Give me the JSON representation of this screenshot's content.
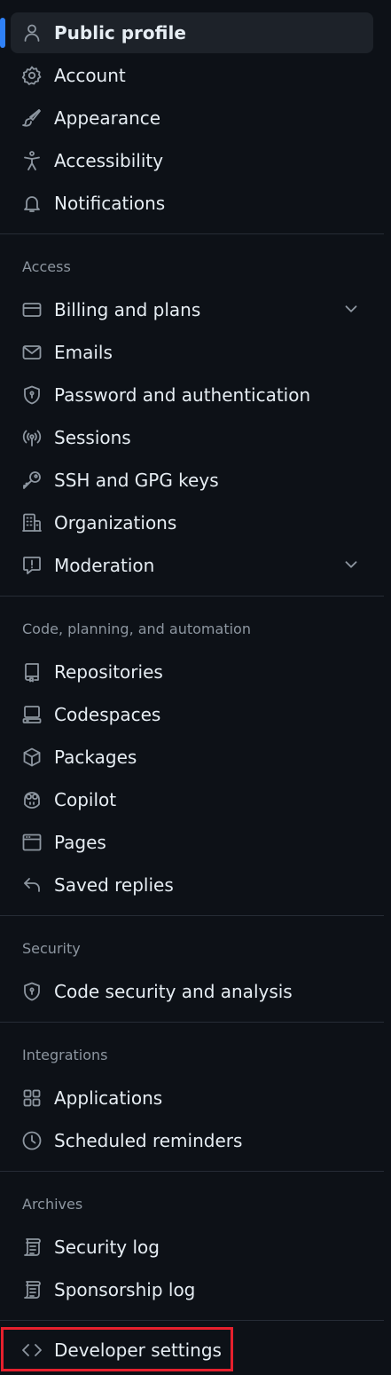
{
  "items_top": {
    "public_profile": "Public profile",
    "account": "Account",
    "appearance": "Appearance",
    "accessibility": "Accessibility",
    "notifications": "Notifications"
  },
  "access": {
    "heading": "Access",
    "billing": "Billing and plans",
    "emails": "Emails",
    "password": "Password and authentication",
    "sessions": "Sessions",
    "ssh": "SSH and GPG keys",
    "organizations": "Organizations",
    "moderation": "Moderation"
  },
  "code": {
    "heading": "Code, planning, and automation",
    "repositories": "Repositories",
    "codespaces": "Codespaces",
    "packages": "Packages",
    "copilot": "Copilot",
    "pages": "Pages",
    "saved_replies": "Saved replies"
  },
  "security": {
    "heading": "Security",
    "code_security": "Code security and analysis"
  },
  "integrations": {
    "heading": "Integrations",
    "applications": "Applications",
    "scheduled_reminders": "Scheduled reminders"
  },
  "archives": {
    "heading": "Archives",
    "security_log": "Security log",
    "sponsorship_log": "Sponsorship log"
  },
  "developer": {
    "label": "Developer settings"
  },
  "colors": {
    "accent": "#2f81f7",
    "highlight": "#e6202d",
    "background": "#0d1117"
  }
}
